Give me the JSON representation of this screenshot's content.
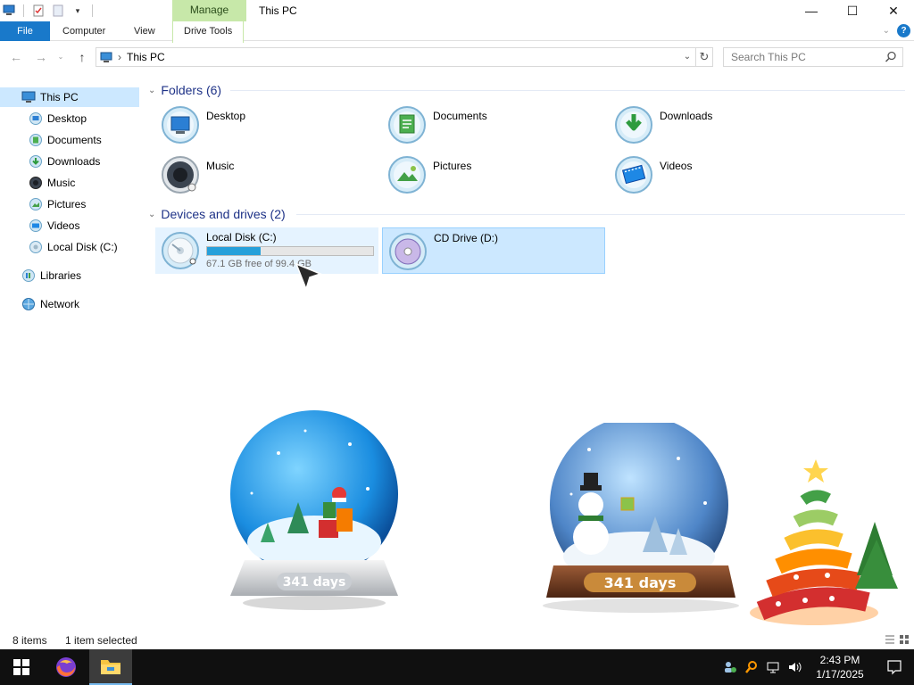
{
  "window": {
    "title": "This PC",
    "context_tab": "Manage",
    "controls": {
      "minimize": "—",
      "maximize": "☐",
      "close": "✕"
    }
  },
  "ribbon": {
    "tabs": [
      "File",
      "Computer",
      "View",
      "Drive Tools"
    ],
    "active_tab": "Drive Tools"
  },
  "address": {
    "path": "This PC",
    "separator": "›",
    "search_placeholder": "Search This PC"
  },
  "nav_pane": {
    "items": [
      {
        "label": "This PC",
        "icon": "computer-icon",
        "selected": true
      },
      {
        "label": "Desktop",
        "icon": "desktop-folder-icon"
      },
      {
        "label": "Documents",
        "icon": "documents-folder-icon"
      },
      {
        "label": "Downloads",
        "icon": "downloads-folder-icon"
      },
      {
        "label": "Music",
        "icon": "music-folder-icon"
      },
      {
        "label": "Pictures",
        "icon": "pictures-folder-icon"
      },
      {
        "label": "Videos",
        "icon": "videos-folder-icon"
      },
      {
        "label": "Local Disk (C:)",
        "icon": "hard-drive-icon"
      },
      {
        "label": "Libraries",
        "icon": "libraries-icon"
      },
      {
        "label": "Network",
        "icon": "network-icon"
      }
    ]
  },
  "content": {
    "folders_header": "Folders (6)",
    "folders": [
      {
        "label": "Desktop",
        "icon": "desktop-folder-icon"
      },
      {
        "label": "Documents",
        "icon": "documents-folder-icon"
      },
      {
        "label": "Downloads",
        "icon": "downloads-folder-icon"
      },
      {
        "label": "Music",
        "icon": "music-folder-icon"
      },
      {
        "label": "Pictures",
        "icon": "pictures-folder-icon"
      },
      {
        "label": "Videos",
        "icon": "videos-folder-icon"
      }
    ],
    "drives_header": "Devices and drives (2)",
    "drives": [
      {
        "label": "Local Disk (C:)",
        "free_text": "67.1 GB free of 99.4 GB",
        "used_fraction": 0.325,
        "icon": "hard-drive-icon",
        "state": "hover"
      },
      {
        "label": "CD Drive (D:)",
        "icon": "cd-drive-icon",
        "state": "selected"
      }
    ]
  },
  "desktop": {
    "countdown_left": "341 days",
    "countdown_right": "341 days"
  },
  "status": {
    "items_count": "8 items",
    "selection": "1 item selected"
  },
  "taskbar": {
    "time": "2:43 PM",
    "date": "1/17/2025"
  },
  "colors": {
    "accent": "#1979ca",
    "manage_tab": "#c7e8a9",
    "selection": "#cce8ff",
    "group_header": "#1e3287",
    "disk_fill": "#26a0da"
  }
}
